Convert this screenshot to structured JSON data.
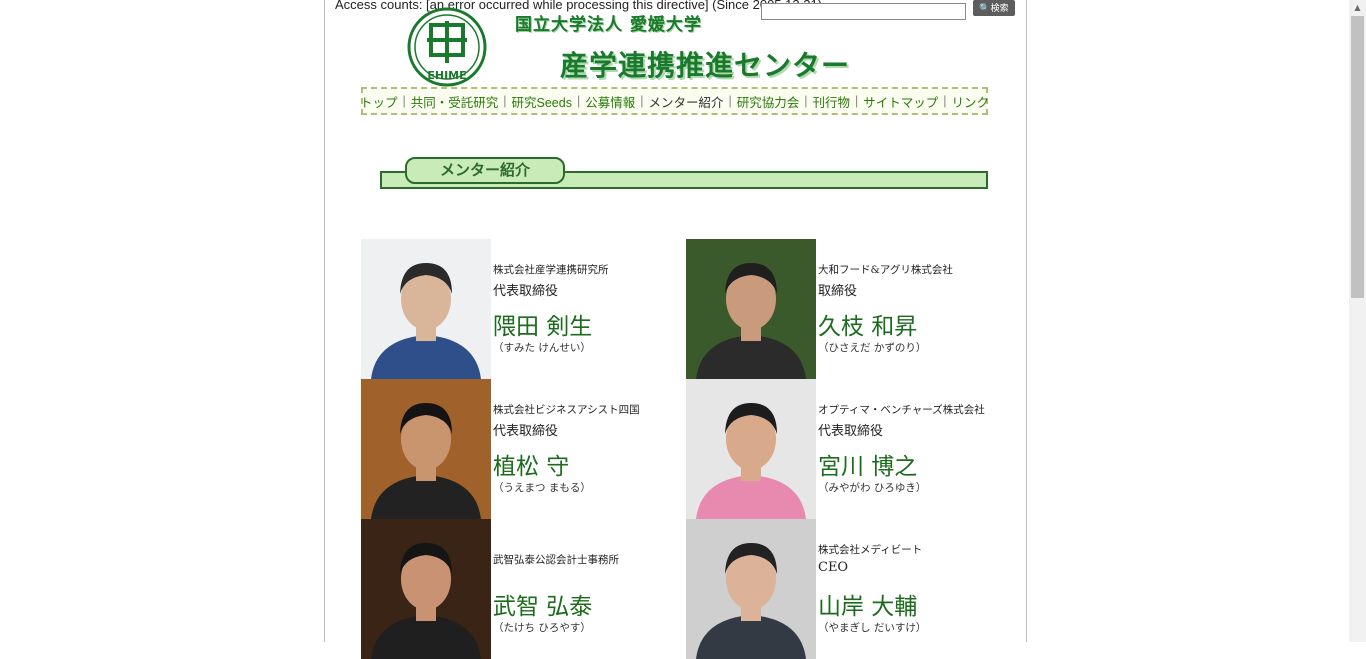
{
  "header": {
    "access_text": "Access counts: [an error occurred while processing this directive] (Since 2005.12.21)",
    "search_placeholder": "",
    "search_button_label": "検索",
    "university_name": "国立大学法人 愛媛大学",
    "center_name": "産学連携推進センター",
    "logo_text": "EHIME"
  },
  "nav": {
    "items": [
      {
        "label": "トップ"
      },
      {
        "label": "共同・受託研究"
      },
      {
        "label": "研究Seeds"
      },
      {
        "label": "公募情報"
      },
      {
        "label": "メンター紹介",
        "current": true
      },
      {
        "label": "研究協力会"
      },
      {
        "label": "刊行物"
      },
      {
        "label": "サイトマップ"
      },
      {
        "label": "リンク"
      }
    ],
    "separator": "|"
  },
  "section": {
    "title": "メンター紹介"
  },
  "mentors": [
    {
      "company": "株式会社産学連携研究所",
      "role": "代表取締役",
      "name": "隈田 剣生",
      "kana": "（すみた けんせい）"
    },
    {
      "company": "大和フード&アグリ株式会社",
      "role": "取締役",
      "name": "久枝 和昇",
      "kana": "（ひさえだ かずのり）"
    },
    {
      "company": "株式会社ビジネスアシスト四国",
      "role": "代表取締役",
      "name": "植松 守",
      "kana": "（うえまつ まもる）"
    },
    {
      "company": "オプティマ・ベンチャーズ株式会社",
      "role": "代表取締役",
      "name": "宮川 博之",
      "kana": "（みやがわ ひろゆき）"
    },
    {
      "company": "武智弘泰公認会計士事務所",
      "role": "",
      "name": "武智 弘泰",
      "kana": "（たけち ひろやす）"
    },
    {
      "company": "株式会社メディビート",
      "role": "CEO",
      "name": "山岸 大輔",
      "kana": "（やまぎし だいすけ）"
    }
  ],
  "colors": {
    "accent": "#1a7a2c",
    "heading_fill": "#c9ebb8",
    "nav_link": "#2b7a0b"
  }
}
